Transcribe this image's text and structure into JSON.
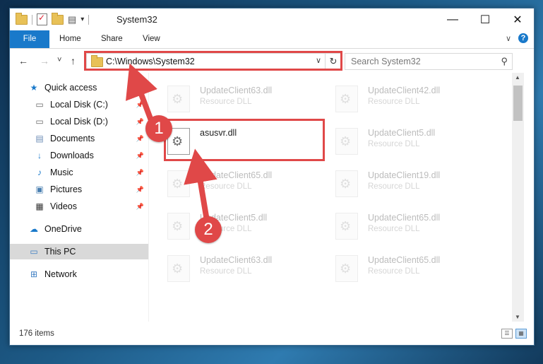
{
  "window": {
    "title": "System32"
  },
  "ribbon": {
    "tabs": [
      "File",
      "Home",
      "Share",
      "View"
    ],
    "expand_glyph": "∨",
    "help_glyph": "?"
  },
  "nav": {
    "back": "←",
    "forward": "→",
    "recent": "˅",
    "up": "↑"
  },
  "address": {
    "path": "C:\\Windows\\System32",
    "drop": "∨",
    "refresh": "↻"
  },
  "search": {
    "placeholder": "Search System32",
    "icon": "⚲"
  },
  "sidebar": {
    "items": [
      {
        "label": "Quick access",
        "icon": "star-icon"
      },
      {
        "label": "Local Disk (C:)",
        "icon": "drive-icon",
        "pinned": true
      },
      {
        "label": "Local Disk (D:)",
        "icon": "drive-icon",
        "pinned": true
      },
      {
        "label": "Documents",
        "icon": "documents-icon",
        "pinned": true
      },
      {
        "label": "Downloads",
        "icon": "download-icon",
        "pinned": true
      },
      {
        "label": "Music",
        "icon": "music-icon",
        "pinned": true
      },
      {
        "label": "Pictures",
        "icon": "pictures-icon",
        "pinned": true
      },
      {
        "label": "Videos",
        "icon": "videos-icon",
        "pinned": true
      },
      {
        "label": "OneDrive",
        "icon": "cloud-icon"
      },
      {
        "label": "This PC",
        "icon": "computer-icon",
        "selected": true
      },
      {
        "label": "Network",
        "icon": "network-icon"
      }
    ]
  },
  "files": {
    "left": [
      {
        "name": "UpdateClient63.dll",
        "type": "Resource DLL"
      },
      {
        "name": "asusvr.dll",
        "type": ""
      },
      {
        "name": "UpdateClient65.dll",
        "type": "Resource DLL"
      },
      {
        "name": "UpdateClient5.dll",
        "type": "Resource DLL"
      },
      {
        "name": "UpdateClient63.dll",
        "type": "Resource DLL"
      }
    ],
    "right": [
      {
        "name": "UpdateClient42.dll",
        "type": "Resource DLL"
      },
      {
        "name": "UpdateClient5.dll",
        "type": "Resource DLL"
      },
      {
        "name": "UpdateClient19.dll",
        "type": "Resource DLL"
      },
      {
        "name": "UpdateClient65.dll",
        "type": "Resource DLL"
      },
      {
        "name": "UpdateClient65.dll",
        "type": "Resource DLL"
      }
    ]
  },
  "status": {
    "items": "176 items"
  },
  "annotations": {
    "badge1": "1",
    "badge2": "2",
    "color": "#e04848"
  },
  "colors": {
    "accent": "#1979ca",
    "highlight": "#e04848"
  }
}
